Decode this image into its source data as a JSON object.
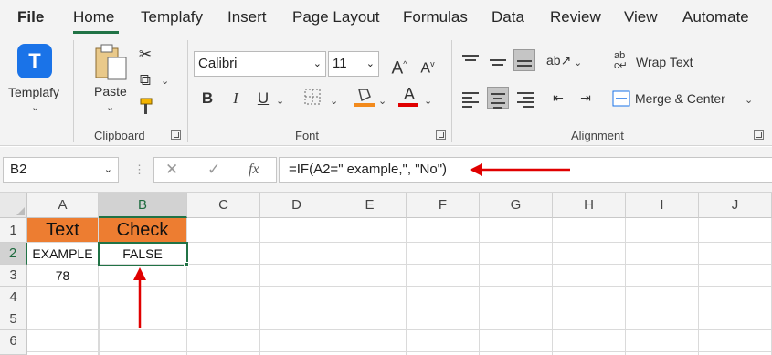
{
  "menu": {
    "tabs": [
      "File",
      "Home",
      "Templafy",
      "Insert",
      "Page Layout",
      "Formulas",
      "Data",
      "Review",
      "View",
      "Automate"
    ],
    "active_tab": "Home"
  },
  "ribbon": {
    "templafy": {
      "label": "Templafy",
      "icon_letter": "T"
    },
    "clipboard": {
      "paste_label": "Paste",
      "group_label": "Clipboard"
    },
    "font": {
      "name": "Calibri",
      "size": "11",
      "group_label": "Font",
      "bold": "B",
      "italic": "I",
      "underline": "U",
      "grow": "A",
      "shrink": "A",
      "font_color_letter": "A"
    },
    "alignment": {
      "wrap_text": "Wrap Text",
      "merge_center": "Merge & Center",
      "group_label": "Alignment"
    }
  },
  "formula_bar": {
    "name_box": "B2",
    "cancel_symbol": "✕",
    "enter_symbol": "✓",
    "fx": "fx",
    "formula": "=IF(A2=\" example,\", \"No\")"
  },
  "sheet": {
    "columns": [
      "A",
      "B",
      "C",
      "D",
      "E",
      "F",
      "G",
      "H",
      "I",
      "J"
    ],
    "rows": [
      "1",
      "2",
      "3",
      "4",
      "5",
      "6"
    ],
    "cells": {
      "A1": "Text",
      "B1": "Check",
      "A2": "EXAMPLE",
      "B2": "FALSE",
      "A3": "78"
    },
    "selected_cell": "B2"
  },
  "colors": {
    "header_fill": "#ed7d31",
    "accent_green": "#217346",
    "annotation_red": "#e00000",
    "font_color_bar": "#e00000",
    "highlight_bar": "#f28a1c"
  }
}
